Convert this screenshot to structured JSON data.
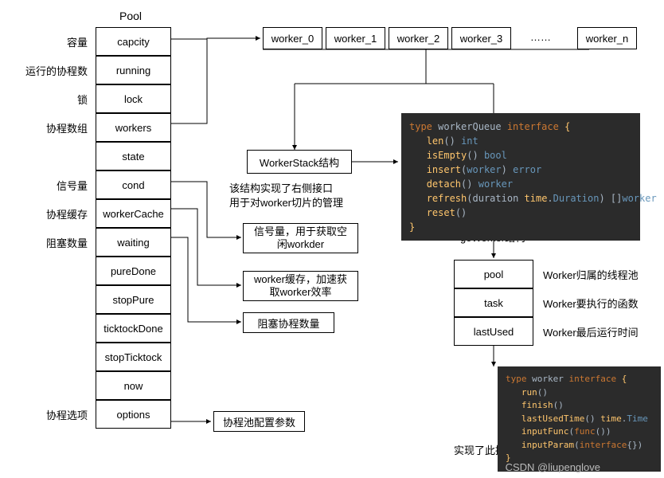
{
  "title": "Pool",
  "pool_labels": [
    "容量",
    "运行的协程数",
    "锁",
    "协程数组",
    "",
    "信号量",
    "协程缓存",
    "阻塞数量",
    "",
    "",
    "",
    "",
    "",
    "协程选项"
  ],
  "pool_fields": [
    "capcity",
    "running",
    "lock",
    "workers",
    "state",
    "cond",
    "workerCache",
    "waiting",
    "pureDone",
    "stopPure",
    "ticktockDone",
    "stopTicktock",
    "now",
    "options"
  ],
  "workers_row": [
    "worker_0",
    "worker_1",
    "worker_2",
    "worker_3",
    "……",
    "worker_n"
  ],
  "worker_stack_box": "WorkerStack结构",
  "worker_stack_desc_l1": "该结构实现了右侧接口",
  "worker_stack_desc_l2": "用于对worker切片的管理",
  "cond_note_l1": "信号量，用于获取空",
  "cond_note_l2": "闲workder",
  "cache_note_l1": "worker缓存，加速获",
  "cache_note_l2": "取worker效率",
  "waiting_note": "阻塞协程数量",
  "options_note": "协程池配置参数",
  "goworker_title": "goWorker结构",
  "goworker_fields": [
    "pool",
    "task",
    "lastUsed"
  ],
  "goworker_desc": [
    "Worker归属的线程池",
    "Worker要执行的函数",
    "Worker最后运行时间"
  ],
  "implements_note": "实现了此接口",
  "watermark": "CSDN @liupenglove",
  "code1": {
    "l1a": "type ",
    "l1b": "workerQueue ",
    "l1c": "interface ",
    "l1d": "{",
    "l2a": "len",
    "l2b": "() ",
    "l2c": "int",
    "l3a": "isEmpty",
    "l3b": "() ",
    "l3c": "bool",
    "l4a": "insert",
    "l4b": "(",
    "l4c": "worker",
    "l4d": ") ",
    "l4e": "error",
    "l5a": "detach",
    "l5b": "() ",
    "l5c": "worker",
    "l6a": "refresh",
    "l6b": "(duration ",
    "l6c": "time",
    "l6d": ".",
    "l6e": "Duration",
    "l6f": ") []",
    "l6g": "worker",
    "l7a": "reset",
    "l7b": "()",
    "l8": "}"
  },
  "code2": {
    "l1a": "type ",
    "l1b": "worker ",
    "l1c": "interface ",
    "l1d": "{",
    "l2a": "run",
    "l2b": "()",
    "l3a": "finish",
    "l3b": "()",
    "l4a": "lastUsedTime",
    "l4b": "() ",
    "l4c": "time",
    "l4d": ".",
    "l4e": "Time",
    "l5a": "inputFunc",
    "l5b": "(",
    "l5c": "func",
    "l5d": "())",
    "l6a": "inputParam",
    "l6b": "(",
    "l6c": "interface",
    "l6d": "{})",
    "l7": "}"
  }
}
